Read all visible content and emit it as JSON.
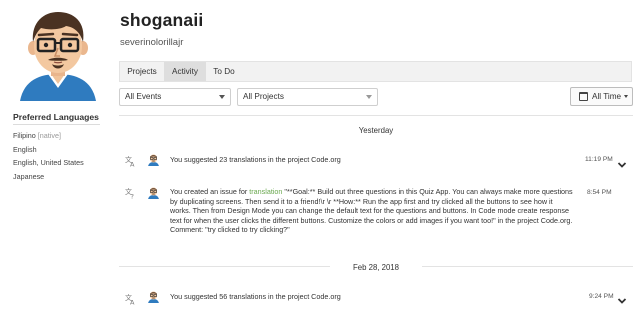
{
  "profile": {
    "username": "shoganaii",
    "full_name": "severinolorillajr"
  },
  "sidebar": {
    "languages_title": "Preferred Languages",
    "languages": [
      {
        "name": "Filipino",
        "tag": "[native]"
      },
      {
        "name": "English",
        "tag": ""
      },
      {
        "name": "English, United States",
        "tag": ""
      },
      {
        "name": "Japanese",
        "tag": ""
      }
    ]
  },
  "tabs": [
    {
      "label": "Projects",
      "active": false
    },
    {
      "label": "Activity",
      "active": true
    },
    {
      "label": "To Do",
      "active": false
    }
  ],
  "filters": {
    "events": "All Events",
    "projects": "All Projects",
    "time": "All Time"
  },
  "feed": {
    "sections": [
      {
        "date": "Yesterday",
        "items": [
          {
            "icon": "translate-icon",
            "text": "You suggested 23 translations in the project Code.org",
            "time": "11:19 PM",
            "expandable": true
          },
          {
            "icon": "issue-icon",
            "text_before": "You created an issue for ",
            "link": "translation",
            "text_after": " \"**Goal:** Build out three questions in this Quiz App. You can always make more questions by duplicating screens. Then send it to a friend!\\r \\r **How:** Run the app first and try clicked all the buttons to see how it works. Then from Design Mode you can change the default text for the questions and buttons. In Code mode create response text for when the user clicks the different buttons. Customize the colors or add images if you want too!\" in the project Code.org.",
            "comment": "Comment: \"try clicked to try clicking?\"",
            "time": "8:54 PM",
            "expandable": false
          }
        ]
      },
      {
        "date": "Feb 28, 2018",
        "items": [
          {
            "icon": "translate-icon",
            "text": "You suggested 56 translations in the project Code.org",
            "time": "9:24 PM",
            "expandable": true
          }
        ]
      }
    ]
  },
  "colors": {
    "link": "#6aa84f",
    "tab_active": "#dedede",
    "tab_bar": "#f2f2f2",
    "avatar_bg": "#7ec8e3",
    "shirt": "#2f7bbf"
  }
}
